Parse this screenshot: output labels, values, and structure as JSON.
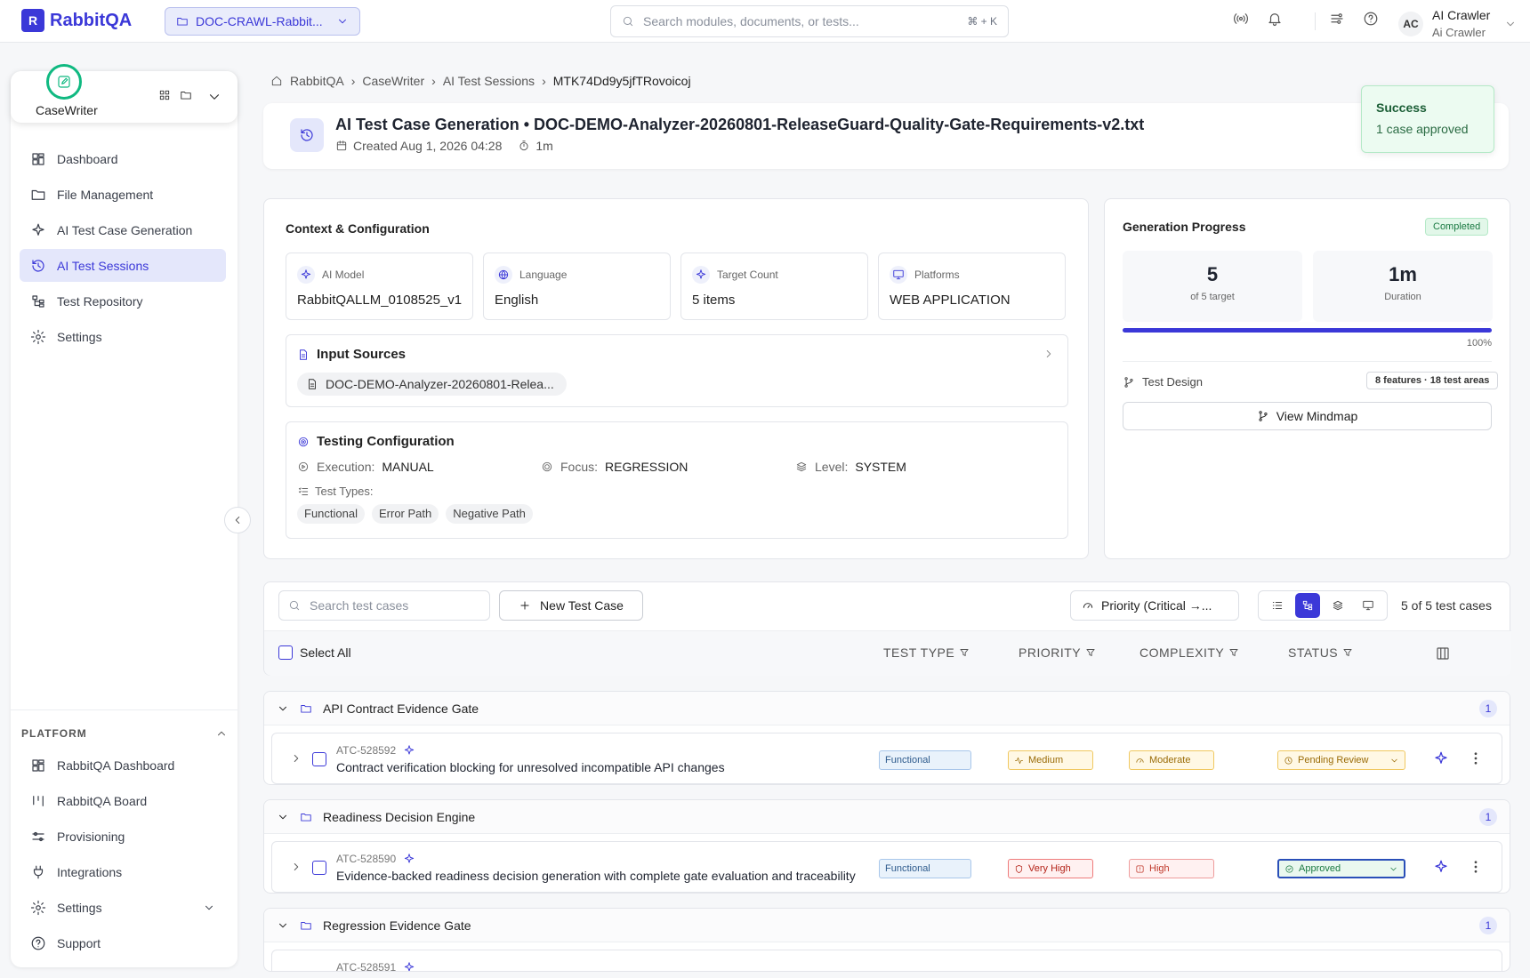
{
  "topbar": {
    "logo_text": "RabbitQA",
    "project": "DOC-CRAWL-Rabbit...",
    "search_placeholder": "Search modules, documents, or tests...",
    "search_shortcut": "⌘ + K",
    "user_initials": "AC",
    "user_name": "AI Crawler",
    "user_role": "Ai Crawler"
  },
  "sidebar": {
    "app_name": "CaseWriter",
    "items": [
      {
        "label": "Dashboard",
        "icon": "grid-icon"
      },
      {
        "label": "File Management",
        "icon": "folder-icon"
      },
      {
        "label": "AI Test Case Generation",
        "icon": "sparkle-icon"
      },
      {
        "label": "AI Test Sessions",
        "icon": "history-icon",
        "active": true
      },
      {
        "label": "Test Repository",
        "icon": "tree-icon"
      },
      {
        "label": "Settings",
        "icon": "gear-icon"
      }
    ],
    "platform_heading": "PLATFORM",
    "platform_items": [
      {
        "label": "RabbitQA Dashboard",
        "icon": "grid-icon"
      },
      {
        "label": "RabbitQA Board",
        "icon": "board-icon"
      },
      {
        "label": "Provisioning",
        "icon": "sliders-icon"
      },
      {
        "label": "Integrations",
        "icon": "plug-icon"
      },
      {
        "label": "Settings",
        "icon": "gear-icon"
      },
      {
        "label": "Support",
        "icon": "help-icon"
      }
    ]
  },
  "breadcrumb": [
    "RabbitQA",
    "CaseWriter",
    "AI Test Sessions",
    "MTK74Dd9y5jfTRovoicoj"
  ],
  "header": {
    "title": "AI Test Case Generation • DOC-DEMO-Analyzer-20260801-ReleaseGuard-Quality-Gate-Requirements-v2.txt",
    "created": "Created Aug 1, 2026 04:28",
    "duration": "1m"
  },
  "toast": {
    "title": "Success",
    "message": "1 case approved"
  },
  "context": {
    "title": "Context & Configuration",
    "cards": [
      {
        "label": "AI Model",
        "value": "RabbitQALLM_0108525_v1"
      },
      {
        "label": "Language",
        "value": "English"
      },
      {
        "label": "Target Count",
        "value": "5 items"
      },
      {
        "label": "Platforms",
        "value": "WEB APPLICATION"
      }
    ],
    "input_sources_title": "Input Sources",
    "input_file": "DOC-DEMO-Analyzer-20260801-Relea...",
    "testing_title": "Testing Configuration",
    "execution_label": "Execution:",
    "execution_value": "MANUAL",
    "focus_label": "Focus:",
    "focus_value": "REGRESSION",
    "level_label": "Level:",
    "level_value": "SYSTEM",
    "test_types_label": "Test Types:",
    "test_types": [
      "Functional",
      "Error Path",
      "Negative Path"
    ]
  },
  "progress": {
    "title": "Generation Progress",
    "status": "Completed",
    "generated": "5",
    "generated_label": "of 5 target",
    "duration": "1m",
    "duration_label": "Duration",
    "percent": 100,
    "percent_label": "100%",
    "test_design_label": "Test Design",
    "test_design_badge": "8 features · 18 test areas",
    "mindmap_button": "View Mindmap"
  },
  "toolbar": {
    "search_placeholder": "Search test cases",
    "new_button": "New Test Case",
    "sort": "Priority (Critical →...",
    "count": "5 of 5 test cases",
    "select_all": "Select All",
    "columns": [
      "TEST TYPE",
      "PRIORITY",
      "COMPLEXITY",
      "STATUS"
    ]
  },
  "groups": [
    {
      "name": "API Contract Evidence Gate",
      "count": "1",
      "cases": [
        {
          "id": "ATC-528592",
          "title": "Contract verification blocking for unresolved incompatible API changes",
          "type": "Functional",
          "priority": "Medium",
          "complexity": "Moderate",
          "status": "Pending Review"
        }
      ]
    },
    {
      "name": "Readiness Decision Engine",
      "count": "1",
      "cases": [
        {
          "id": "ATC-528590",
          "title": "Evidence-backed readiness decision generation with complete gate evaluation and traceability",
          "type": "Functional",
          "priority": "Very High",
          "complexity": "High",
          "status": "Approved"
        }
      ]
    },
    {
      "name": "Regression Evidence Gate",
      "count": "1",
      "cases": [
        {
          "id": "ATC-528591"
        }
      ]
    }
  ]
}
